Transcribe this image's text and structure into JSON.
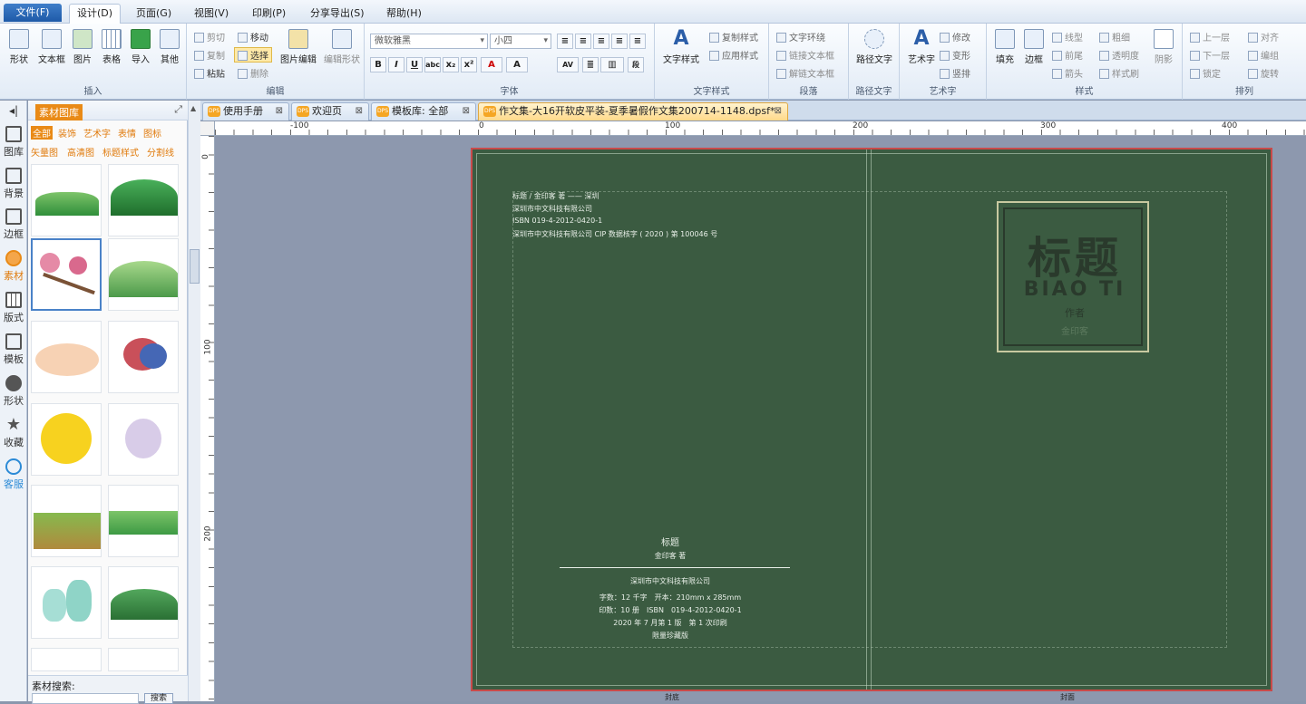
{
  "menu": {
    "file": "文件(F)",
    "design": "设计(D)",
    "page": "页面(G)",
    "view": "视图(V)",
    "print": "印刷(P)",
    "share": "分享导出(S)",
    "help": "帮助(H)"
  },
  "ribbon": {
    "insert": {
      "label": "插入",
      "shape": "形状",
      "textbox": "文本框",
      "image": "图片",
      "table": "表格",
      "import": "导入",
      "other": "其他"
    },
    "edit": {
      "label": "编辑",
      "cut": "剪切",
      "copy": "复制",
      "paste": "粘贴",
      "move": "移动",
      "select": "选择",
      "delete": "删除",
      "imgedit": "图片编辑",
      "shapeedit": "编辑形状"
    },
    "font": {
      "label": "字体",
      "family": "微软雅黑",
      "size": "小四"
    },
    "textstyle": {
      "label": "文字样式",
      "main": "文字样式",
      "copy": "复制样式",
      "apply": "应用样式"
    },
    "para": {
      "label": "段落",
      "wrap": "文字环绕",
      "link": "链接文本框",
      "unlink": "解链文本框"
    },
    "path": {
      "label": "路径文字",
      "main": "路径文字"
    },
    "art": {
      "label": "艺术字",
      "main": "艺术字",
      "modify": "修改",
      "transform": "变形",
      "vertical": "竖排"
    },
    "style": {
      "label": "样式",
      "fill": "填充",
      "border": "边框",
      "linetype": "线型",
      "frontend": "前尾",
      "arrow": "箭头",
      "thickness": "粗细",
      "opacity": "透明度",
      "brush": "样式刷",
      "shadow": "阴影"
    },
    "arrange": {
      "label": "排列",
      "up": "上一层",
      "down": "下一层",
      "lock": "锁定",
      "align": "对齐",
      "group": "编组",
      "rotate": "旋转"
    }
  },
  "sidebar": [
    "图库",
    "背景",
    "边框",
    "素材",
    "版式",
    "模板",
    "形状",
    "收藏",
    "客服"
  ],
  "panel": {
    "title": "素材图库",
    "cats1": [
      "全部",
      "装饰",
      "艺术字",
      "表情",
      "图标"
    ],
    "cats2": [
      "矢量图",
      "高清图",
      "标题样式",
      "分割线"
    ],
    "search_label": "素材搜索:",
    "search_btn": "搜索"
  },
  "tabs": [
    "使用手册",
    "欢迎页",
    "模板库: 全部",
    "作文集-大16开软皮平装-夏季暑假作文集200714-1148.dpsf*"
  ],
  "ruler": {
    "h": [
      "-100",
      "0",
      "100",
      "200",
      "300",
      "400"
    ],
    "v": [
      "0",
      "100",
      "200"
    ]
  },
  "book": {
    "back_lines": [
      "标题 / 金印客 著 —— 深圳",
      "深圳市中文科技有限公司",
      "ISBN 019-4-2012-0420-1",
      "深圳市中文科技有限公司 CIP 数据核字 ( 2020 ) 第 100046 号"
    ],
    "back_title": "标题",
    "back_author": "金印客 著",
    "back_company": "深圳市中文科技有限公司",
    "back_info": [
      "字数：12 千字　开本：210mm x 285mm",
      "印数：10 册　ISBN　019-4-2012-0420-1",
      "2020 年 7 月第 1 版　第 1 次印刷",
      "限量珍藏版"
    ],
    "front_title": "标题",
    "front_pinyin": "BIAO TI",
    "front_author_label": "作者",
    "front_author": "金印客",
    "page_back": "封底",
    "page_front": "封面"
  }
}
